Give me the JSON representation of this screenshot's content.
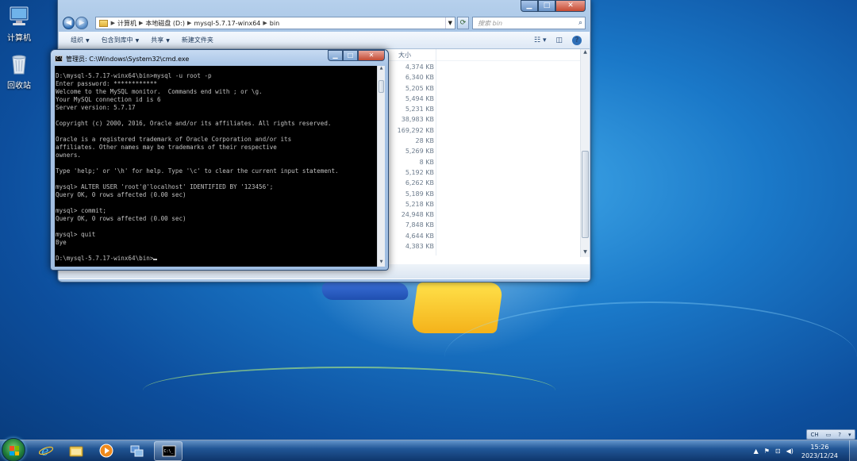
{
  "desktop": {
    "icons": [
      {
        "label": "计算机",
        "icon": "computer-icon"
      },
      {
        "label": "回收站",
        "icon": "recycle-bin-icon"
      }
    ]
  },
  "explorer": {
    "address": {
      "segments": [
        "计算机",
        "本地磁盘 (D:)",
        "mysql-5.7.17-winx64",
        "bin"
      ]
    },
    "search_placeholder": "搜索 bin",
    "toolbar": {
      "organize": "组织",
      "include_library": "包含到库中",
      "share": "共享",
      "new_folder": "新建文件夹"
    },
    "column_size": "大小",
    "sizes": [
      "4,374 KB",
      "6,340 KB",
      "5,205 KB",
      "5,494 KB",
      "5,231 KB",
      "38,983 KB",
      "169,292 KB",
      "28 KB",
      "5,269 KB",
      "8 KB",
      "5,192 KB",
      "6,262 KB",
      "5,189 KB",
      "5,218 KB",
      "24,948 KB",
      "7,848 KB",
      "4,644 KB",
      "4,383 KB"
    ]
  },
  "cmd": {
    "title": "管理员: C:\\Windows\\System32\\cmd.exe",
    "lines": [
      "D:\\mysql-5.7.17-winx64\\bin>mysql -u root -p",
      "Enter password: ************",
      "Welcome to the MySQL monitor.  Commands end with ; or \\g.",
      "Your MySQL connection id is 6",
      "Server version: 5.7.17",
      "",
      "Copyright (c) 2000, 2016, Oracle and/or its affiliates. All rights reserved.",
      "",
      "Oracle is a registered trademark of Oracle Corporation and/or its",
      "affiliates. Other names may be trademarks of their respective",
      "owners.",
      "",
      "Type 'help;' or '\\h' for help. Type '\\c' to clear the current input statement.",
      "",
      "mysql> ALTER USER 'root'@'localhost' IDENTIFIED BY '123456';",
      "Query OK, 0 rows affected (0.00 sec)",
      "",
      "mysql> commit;",
      "Query OK, 0 rows affected (0.00 sec)",
      "",
      "mysql> quit",
      "Bye",
      ""
    ],
    "prompt": "D:\\mysql-5.7.17-winx64\\bin>"
  },
  "taskbar": {
    "apps": [
      "ie-icon",
      "explorer-icon",
      "media-player-icon",
      "network-app-icon",
      "cmd-icon"
    ],
    "langbar": {
      "lang": "CH"
    },
    "tray_arrow": "▲",
    "clock_time": "15:26",
    "clock_date": "2023/12/24"
  }
}
